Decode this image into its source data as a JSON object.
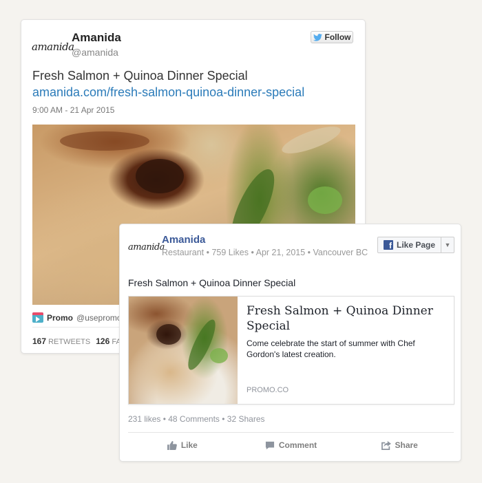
{
  "tweet": {
    "logo_text": "amanida",
    "name": "Amanida",
    "handle": "@amanida",
    "follow_label": "Follow",
    "text": "Fresh Salmon + Quinoa Dinner Special",
    "link": "amanida.com/fresh-salmon-quinoa-dinner-special",
    "timestamp": "9:00 AM - 21 Apr 2015",
    "promo_label": "Promo",
    "promo_handle": "@usepromo",
    "retweets_count": "167",
    "retweets_label": "RETWEETS",
    "favorites_count": "126",
    "favorites_label": "FAVO",
    "icons": [
      "twitter-bird-icon",
      "promo-icon"
    ],
    "colors": {
      "link": "#2b7bb9",
      "twitter_blue": "#55acee"
    }
  },
  "facebook": {
    "logo_text": "amanida",
    "name": "Amanida",
    "meta": "Restaurant • 759 Likes • Apr 21, 2015 • Vancouver BC",
    "like_page_label": "Like Page",
    "post_text": "Fresh Salmon + Quinoa Dinner Special",
    "attachment": {
      "title": "Fresh Salmon + Quinoa Dinner Special",
      "description": "Come celebrate the start of summer with Chef Gordon's latest creation.",
      "domain": "PROMO.CO"
    },
    "counts": "231 likes • 48 Comments • 32 Shares",
    "actions": {
      "like": "Like",
      "comment": "Comment",
      "share": "Share"
    },
    "icons": [
      "facebook-f-icon",
      "dropdown-caret-icon",
      "thumbs-up-icon",
      "comment-icon",
      "share-icon"
    ],
    "colors": {
      "brand": "#3b5998"
    }
  }
}
